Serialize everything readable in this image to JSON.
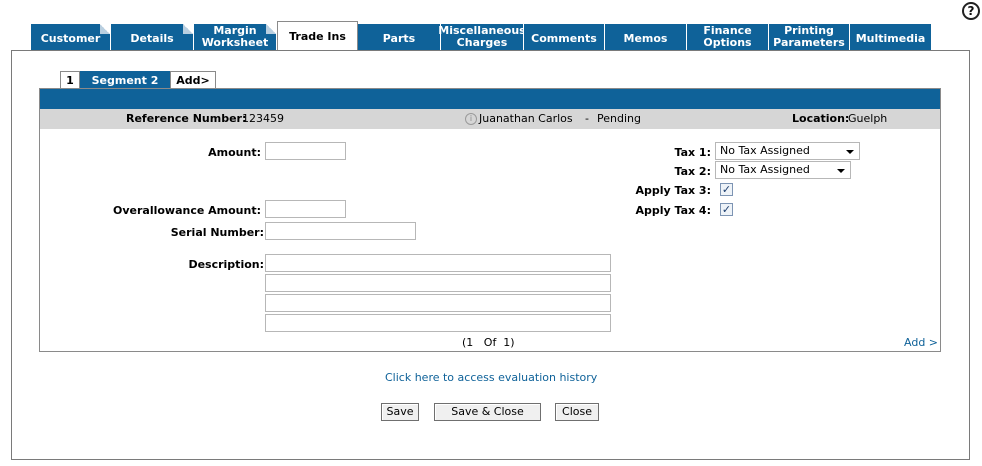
{
  "tabs": [
    {
      "label": "Customer",
      "active": false
    },
    {
      "label": "Details",
      "active": false
    },
    {
      "label": "Margin\nWorksheet",
      "active": false
    },
    {
      "label": "Trade Ins",
      "active": true
    },
    {
      "label": "Parts",
      "active": false
    },
    {
      "label": "Miscellaneous\nCharges",
      "active": false
    },
    {
      "label": "Comments",
      "active": false
    },
    {
      "label": "Memos",
      "active": false
    },
    {
      "label": "Finance\nOptions",
      "active": false
    },
    {
      "label": "Printing\nParameters",
      "active": false
    },
    {
      "label": "Multimedia",
      "active": false
    }
  ],
  "help_symbol": "?",
  "segment_tabs": [
    "1",
    "Segment 2",
    "Add>"
  ],
  "info": {
    "ref_label": "Reference Number:",
    "ref_value": "123459",
    "customer": "Juanathan Carlos",
    "separator": "-",
    "status": "Pending",
    "info_icon": "i",
    "location_label": "Location:",
    "location_value": "Guelph"
  },
  "form": {
    "amount_label": "Amount:",
    "amount_value": "",
    "overallowance_label": "Overallowance Amount:",
    "overallowance_value": "",
    "serial_label": "Serial Number:",
    "serial_value": "",
    "description_label": "Description:",
    "description_lines": [
      "",
      "",
      "",
      ""
    ],
    "tax1_label": "Tax 1:",
    "tax1_value": "No Tax Assigned",
    "tax2_label": "Tax 2:",
    "tax2_value": "No Tax Assigned",
    "apply_tax3_label": "Apply Tax 3:",
    "apply_tax3_checked": true,
    "apply_tax4_label": "Apply Tax 4:",
    "apply_tax4_checked": true,
    "check_mark": "✓"
  },
  "pager": {
    "text": "(1   Of  1)"
  },
  "add_link": "Add >",
  "history_link": "Click here to access evaluation history",
  "buttons": {
    "save": "Save",
    "save_close": "Save & Close",
    "close": "Close"
  }
}
